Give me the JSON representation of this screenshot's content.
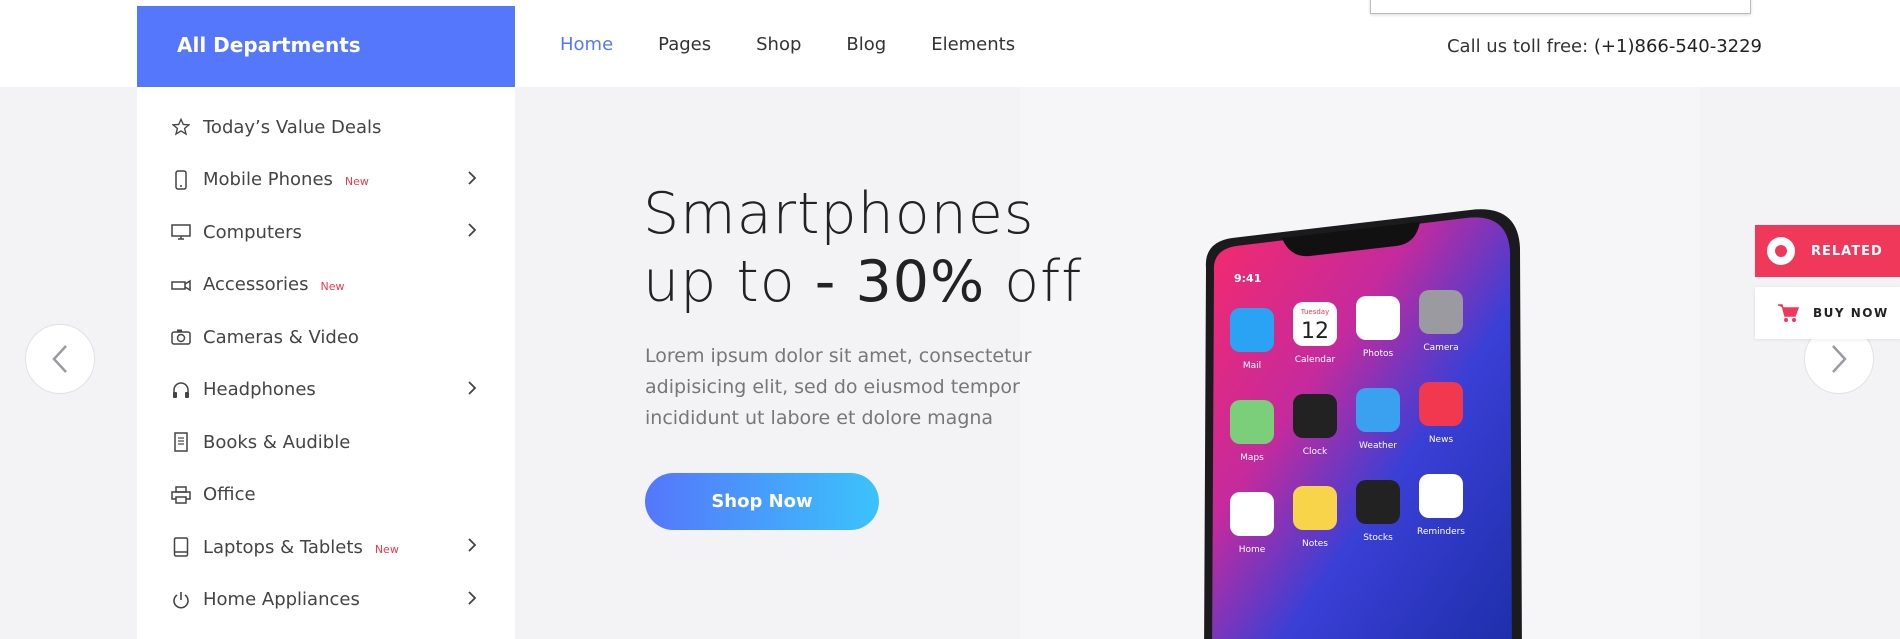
{
  "header": {
    "departments_label": "All Departments",
    "nav": [
      {
        "label": "Home",
        "active": true
      },
      {
        "label": "Pages",
        "active": false
      },
      {
        "label": "Shop",
        "active": false
      },
      {
        "label": "Blog",
        "active": false
      },
      {
        "label": "Elements",
        "active": false
      }
    ],
    "toll_label": "Call us toll free:",
    "toll_number": "(+1)866-540-3229"
  },
  "sidebar": {
    "items": [
      {
        "label": "Today’s Value Deals",
        "icon": "star-icon",
        "badge": "",
        "arrow": false
      },
      {
        "label": "Mobile Phones",
        "icon": "mobile-icon",
        "badge": "New",
        "arrow": true
      },
      {
        "label": "Computers",
        "icon": "monitor-icon",
        "badge": "",
        "arrow": true
      },
      {
        "label": "Accessories",
        "icon": "projector-icon",
        "badge": "New",
        "arrow": false
      },
      {
        "label": "Cameras & Video",
        "icon": "camera-icon",
        "badge": "",
        "arrow": false
      },
      {
        "label": "Headphones",
        "icon": "headphones-icon",
        "badge": "",
        "arrow": true
      },
      {
        "label": "Books & Audible",
        "icon": "book-icon",
        "badge": "",
        "arrow": false
      },
      {
        "label": "Office",
        "icon": "printer-icon",
        "badge": "",
        "arrow": false
      },
      {
        "label": "Laptops & Tablets",
        "icon": "tablet-icon",
        "badge": "New",
        "arrow": true
      },
      {
        "label": "Home Appliances",
        "icon": "power-icon",
        "badge": "",
        "arrow": true
      }
    ]
  },
  "hero": {
    "headline_line1": "Smartphones",
    "headline_prefix": "up to ",
    "headline_bold": "- 30%",
    "headline_suffix": " off",
    "description": "Lorem ipsum dolor sit amet, consectetur adipisicing elit, sed do eiusmod tempor incididunt ut labore et dolore magna",
    "cta_label": "Shop Now"
  },
  "phone": {
    "time": "9:41",
    "apps": [
      {
        "label": "Mail"
      },
      {
        "label": "Calendar"
      },
      {
        "label": "Photos"
      },
      {
        "label": "Camera"
      },
      {
        "label": "Maps"
      },
      {
        "label": "Clock"
      },
      {
        "label": "Weather"
      },
      {
        "label": "News"
      },
      {
        "label": "Home"
      },
      {
        "label": "Notes"
      },
      {
        "label": "Stocks"
      },
      {
        "label": "Reminders"
      }
    ],
    "calendar_day": "Tuesday",
    "calendar_date": "12"
  },
  "widgets": {
    "related_label": "RELATED",
    "buynow_label": "BUY NOW"
  },
  "colors": {
    "accent": "#5577fb",
    "badge": "#f0394d",
    "related_bg": "#f0385a"
  }
}
